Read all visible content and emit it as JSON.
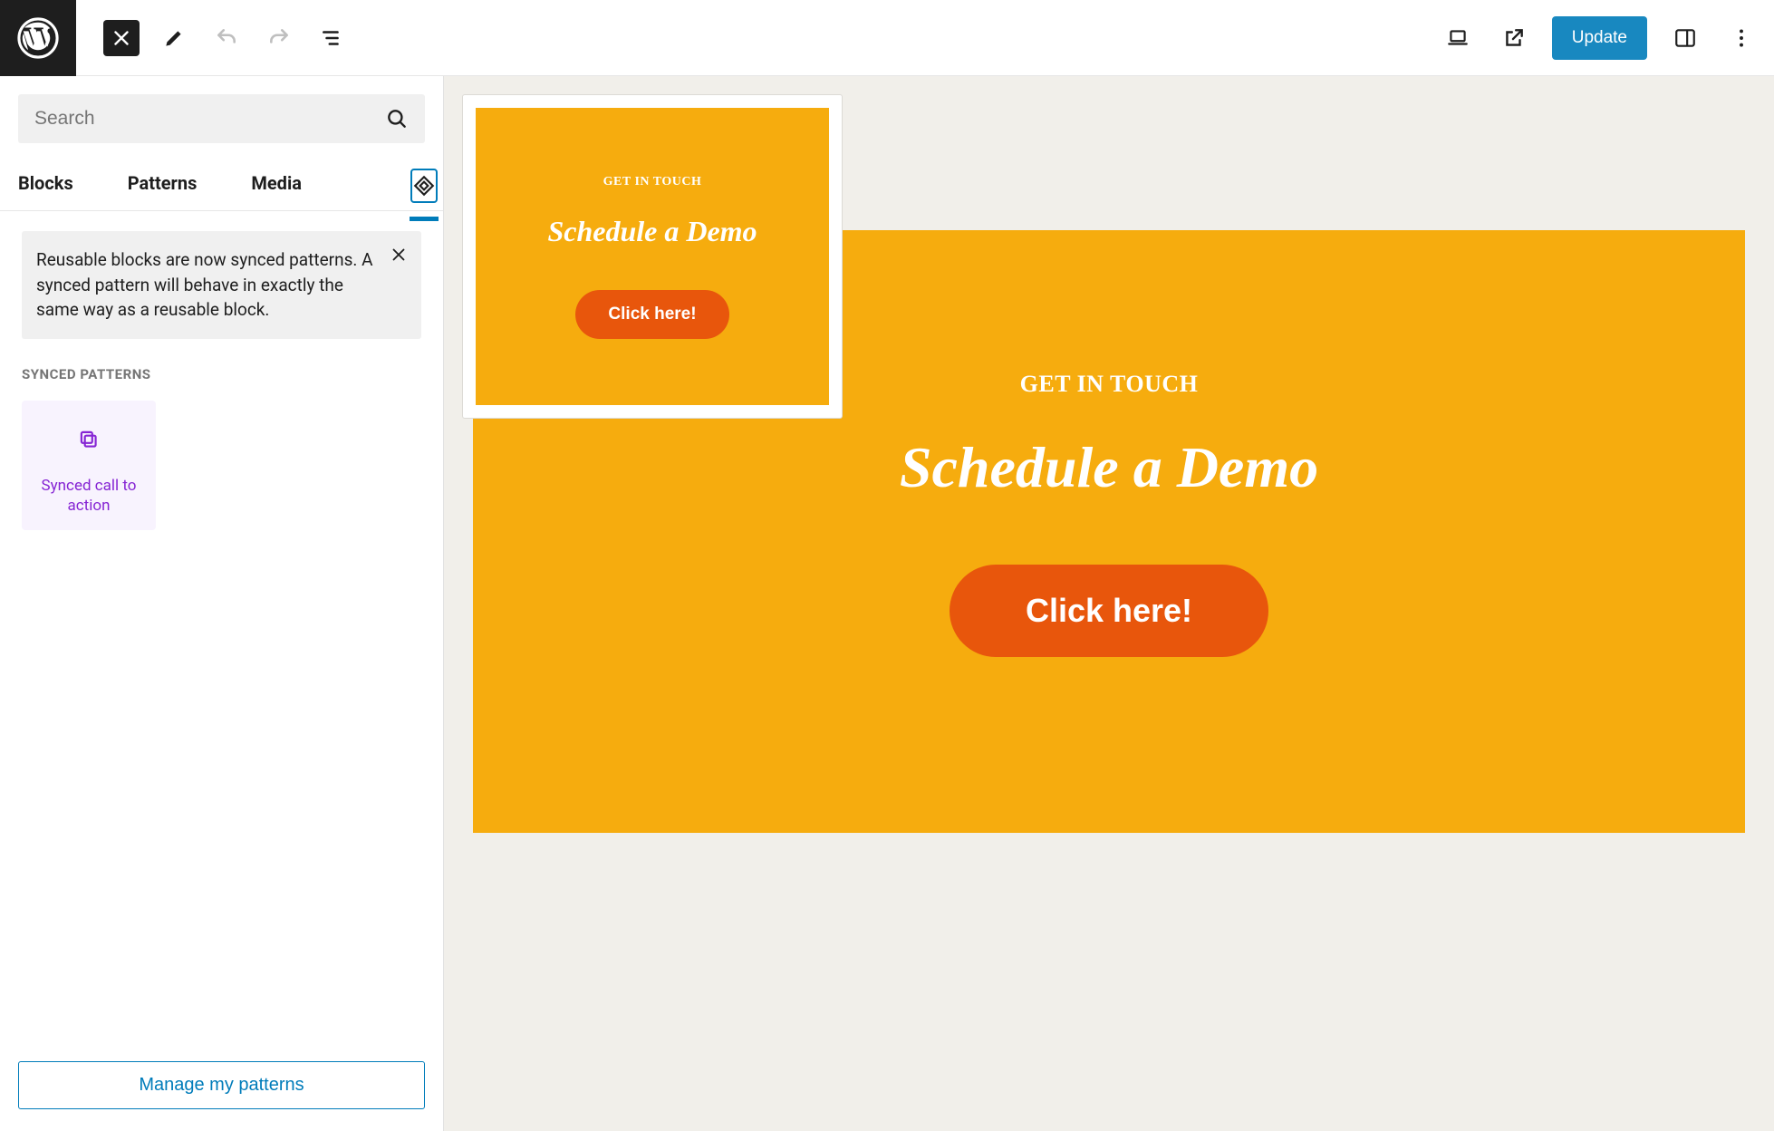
{
  "topbar": {
    "update_label": "Update"
  },
  "inserter": {
    "search_placeholder": "Search",
    "tabs": {
      "blocks": "Blocks",
      "patterns": "Patterns",
      "media": "Media"
    },
    "notice": "Reusable blocks are now synced patterns. A synced pattern will behave in exactly the same way as a reusable block.",
    "section_label": "SYNCED PATTERNS",
    "pattern_card_label": "Synced call to action",
    "manage_label": "Manage my patterns"
  },
  "cta": {
    "eyebrow": "GET IN TOUCH",
    "heading": "Schedule a Demo",
    "button": "Click here!"
  }
}
